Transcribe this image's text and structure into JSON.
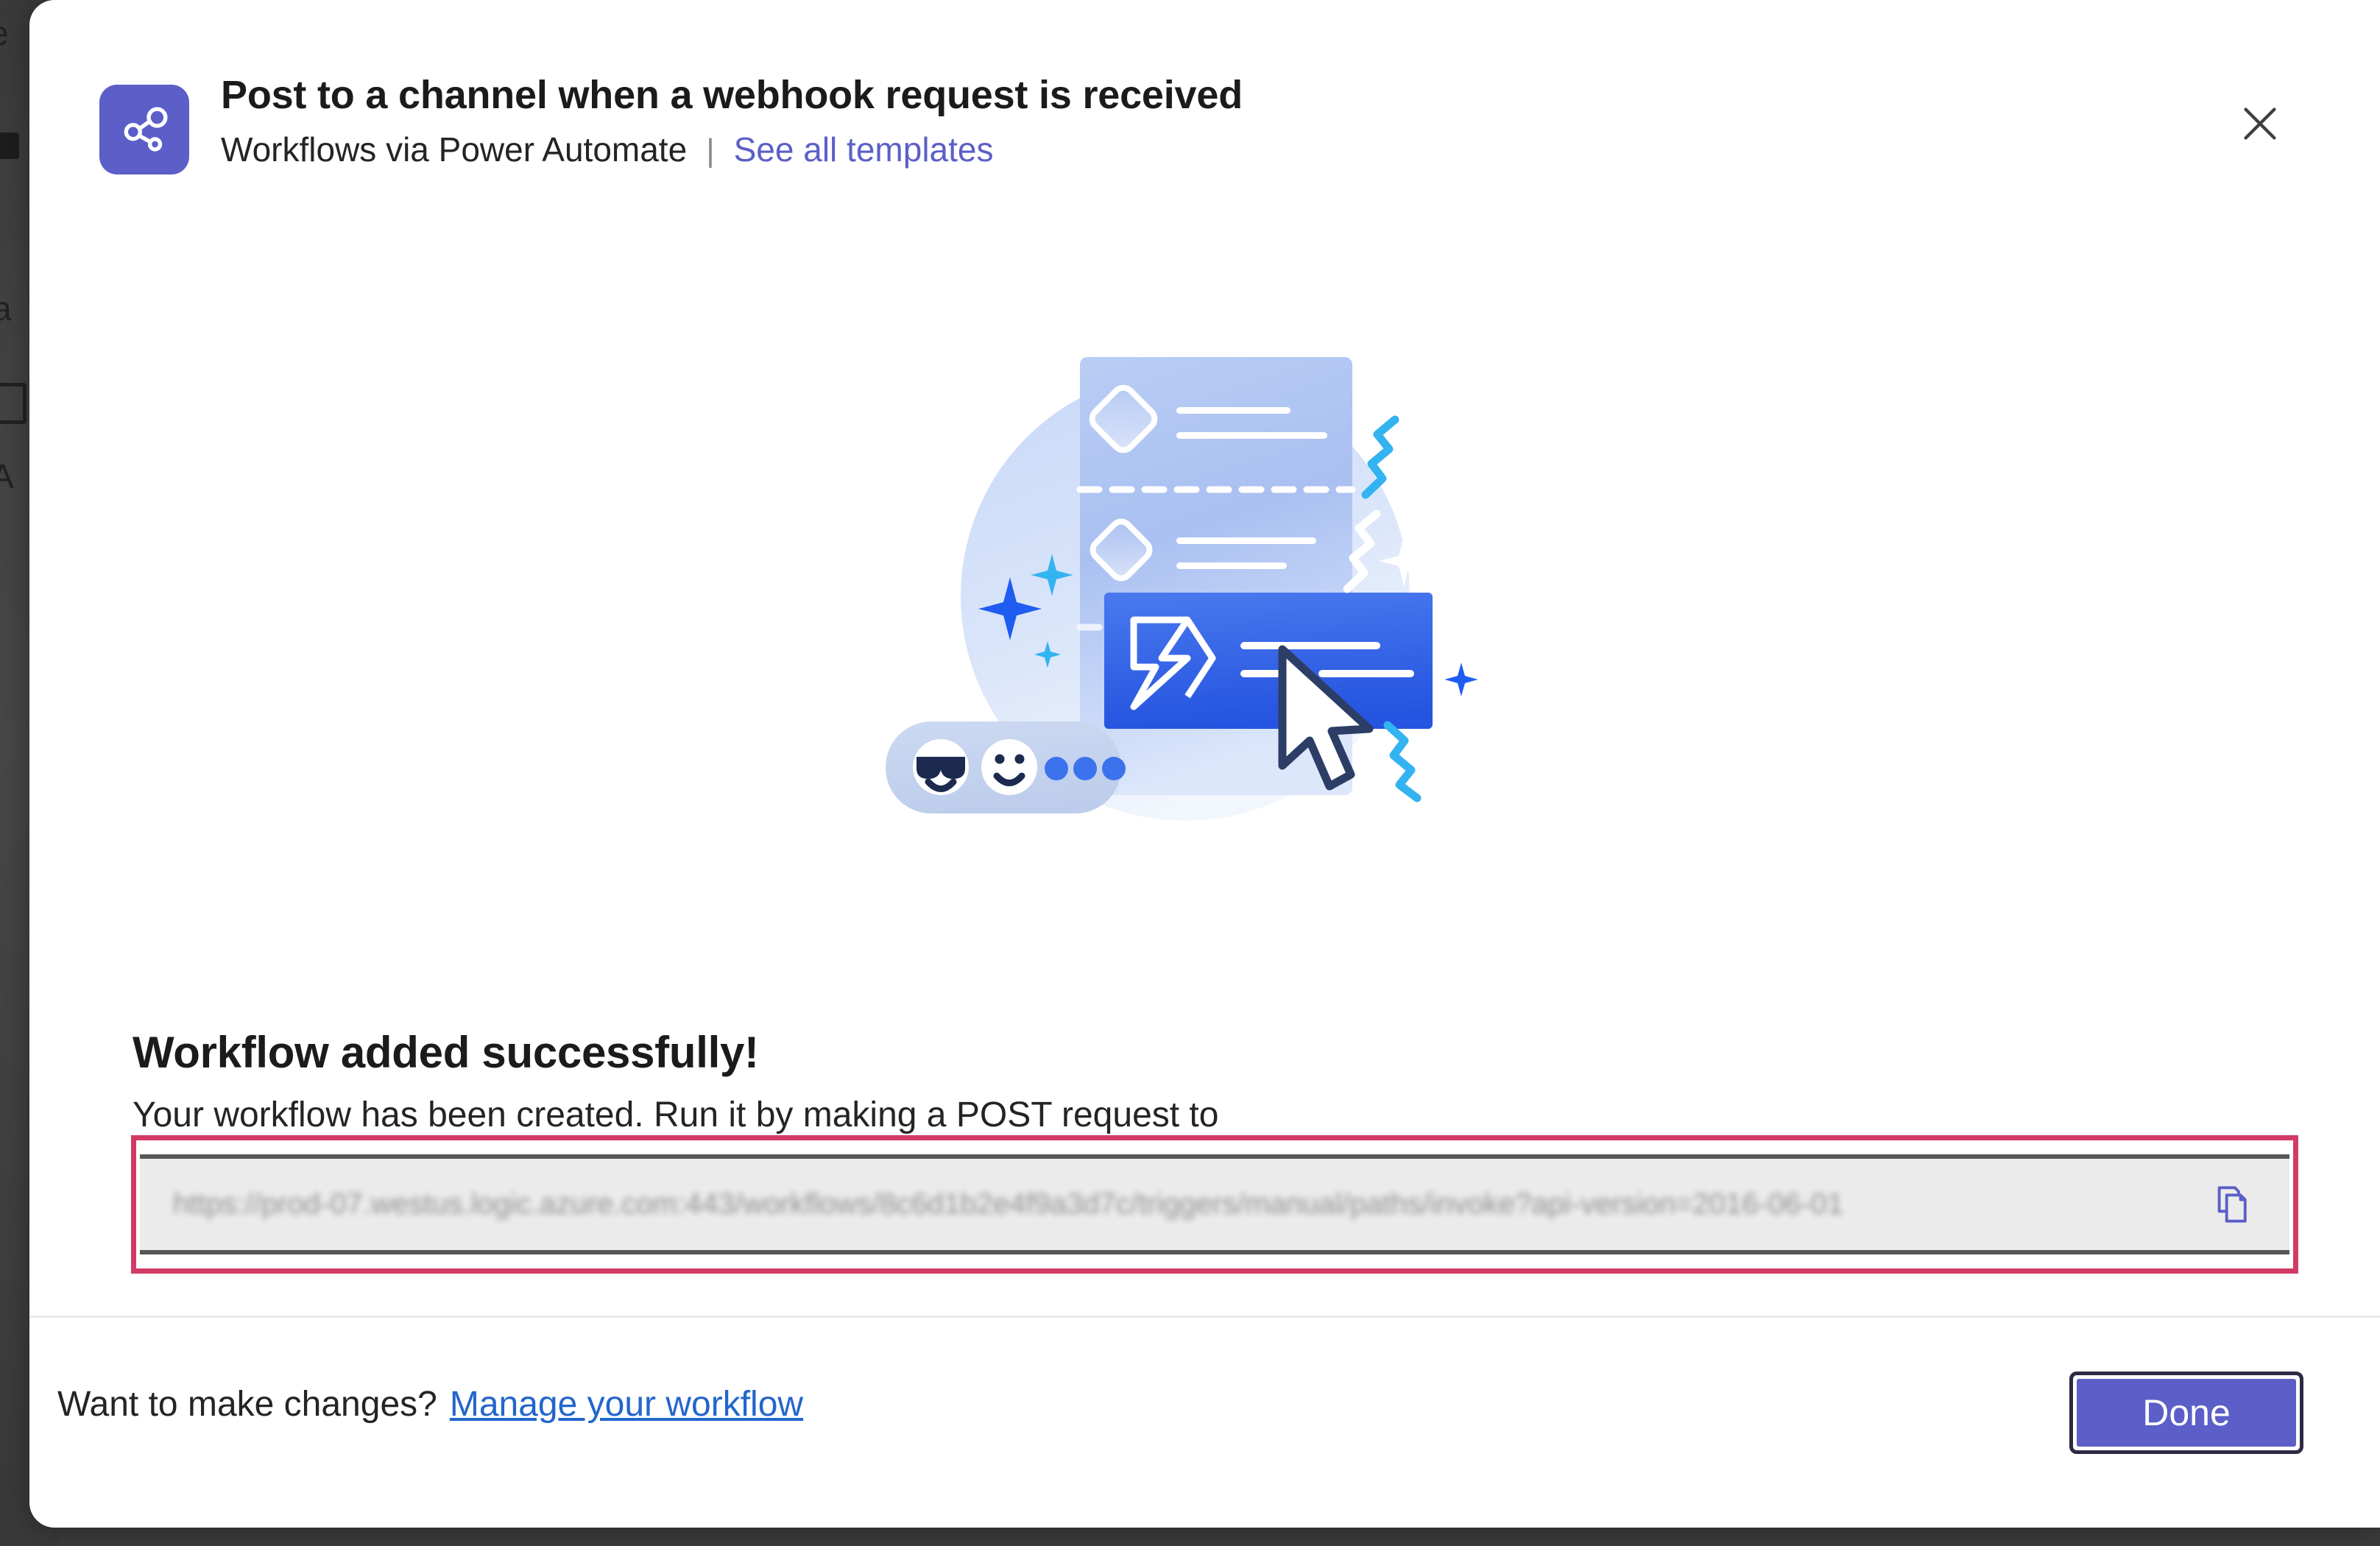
{
  "background": {
    "ghost_glyphs": [
      "e",
      "a",
      "A"
    ],
    "strip_color": "#414141"
  },
  "header": {
    "app_icon": "share-nodes-icon",
    "title": "Post to a channel when a webhook request is received",
    "subtitle": "Workflows via Power Automate",
    "separator": "|",
    "see_all_templates": "See all templates",
    "close_icon": "close-icon",
    "icon_bg_color": "#5b5fc7",
    "link_color": "#5b5fc7"
  },
  "illustration": {
    "name": "workflow-success-illustration",
    "elements": [
      "circle-backdrop",
      "workflow-card",
      "diamond-icon",
      "dashed-divider",
      "power-automate-row",
      "power-automate-logo",
      "cursor-arrow",
      "emoji-reaction-pill",
      "sunglasses-emoji",
      "smiley-emoji",
      "sparkle-star",
      "zigzag-squiggle"
    ],
    "colors": {
      "card": "#a8c0f0",
      "highlight_row": "#2f63e8",
      "circle": "#d3e0f7",
      "squiggle_cyan": "#34b3f1",
      "sparkle_blue": "#1f5cf0",
      "cursor_outline": "#2c3e66"
    }
  },
  "success": {
    "heading": "Workflow added successfully!",
    "description": "Your workflow has been created. Run it by making a POST request to",
    "url_value": "https://prod-07.westus.logic.azure.com:443/workflows/8c6d1b2e4f9a3d7c/triggers/manual/paths/invoke?api-version=2016-06-01",
    "url_is_redacted": true,
    "copy_icon": "copy-icon",
    "highlight_color": "#d13b64",
    "field_bg_color": "#ebebeb"
  },
  "footer": {
    "prompt": "Want to make changes?",
    "manage_link": "Manage your workflow",
    "done_label": "Done",
    "link_color": "#2266cc",
    "done_color": "#5b5fc7"
  }
}
